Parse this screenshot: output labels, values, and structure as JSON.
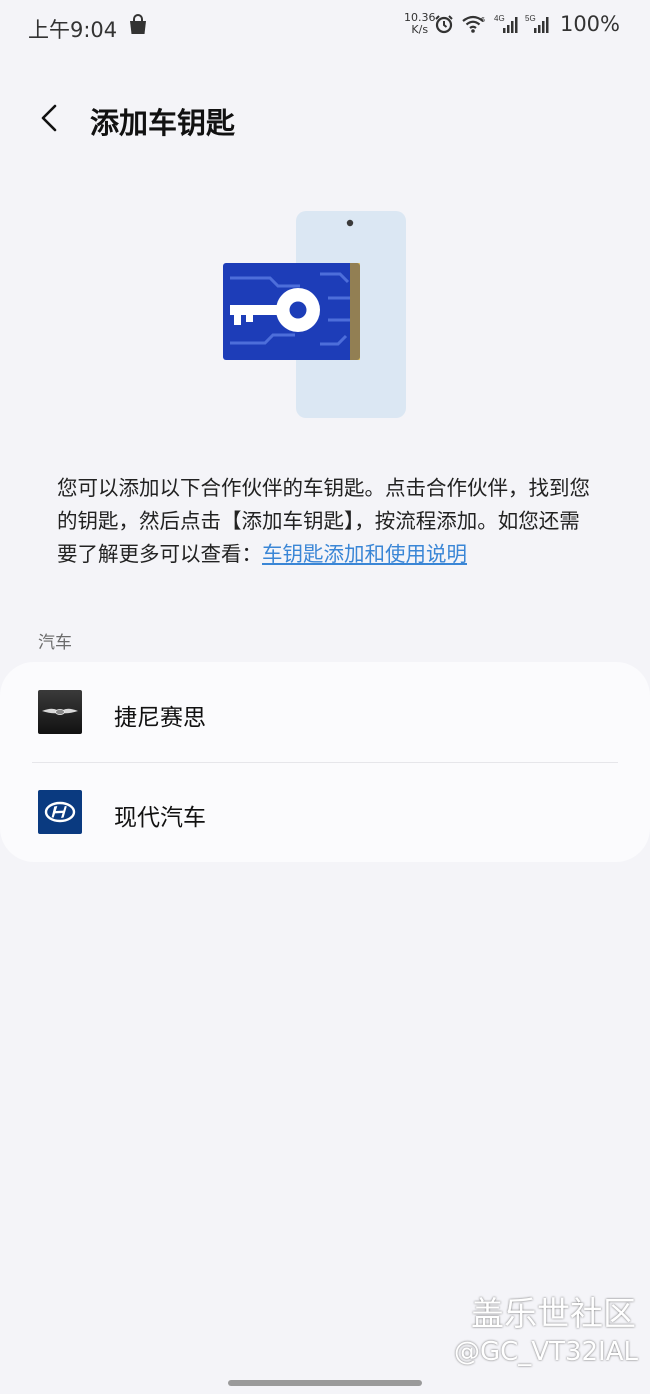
{
  "status_bar": {
    "time": "上午9:04",
    "net_speed_value": "10.36",
    "net_speed_unit": "K/s",
    "signal_4g": "4G",
    "signal_5g": "5G",
    "battery": "100%",
    "icons": [
      "bag-icon",
      "alarm-icon",
      "wifi-icon",
      "signal-4g-icon",
      "signal-5g-icon"
    ]
  },
  "header": {
    "title": "添加车钥匙",
    "back_icon": "chevron-left-icon"
  },
  "description": {
    "text": "您可以添加以下合作伙伴的车钥匙。点击合作伙伴，找到您的钥匙，然后点击【添加车钥匙】，按流程添加。如您还需要了解更多可以查看：",
    "link": "车钥匙添加和使用说明"
  },
  "section": {
    "label": "汽车",
    "partners": [
      {
        "name": "捷尼赛思",
        "logo": "genesis-logo-icon"
      },
      {
        "name": "现代汽车",
        "logo": "hyundai-logo-icon"
      }
    ]
  },
  "watermark": {
    "title": "盖乐世社区",
    "user": "@GC_VT32IAL"
  },
  "colors": {
    "background": "#f4f4f8",
    "card": "#fbfbfd",
    "link": "#3a86d6",
    "key_card": "#1d3db8"
  }
}
